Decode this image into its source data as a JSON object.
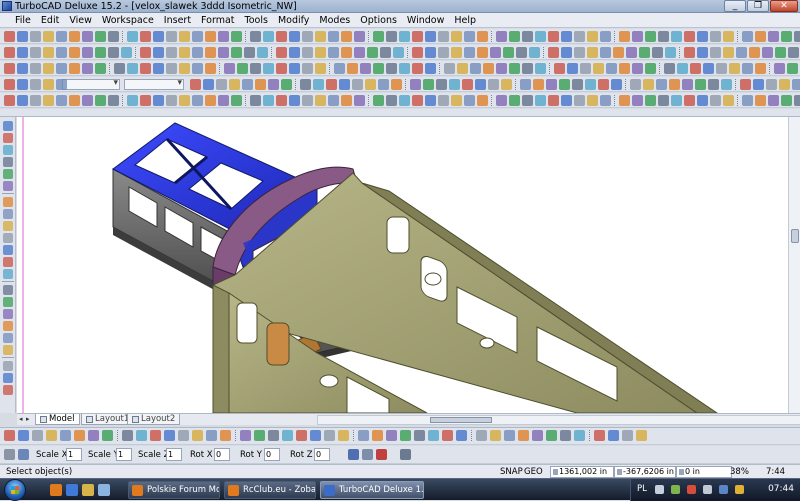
{
  "window": {
    "title": "TurboCAD Deluxe 15.2 - [velox_slawek 3ddd Isometric_NW]",
    "controls": {
      "minimize": "_",
      "restore": "❐",
      "close": "✕"
    }
  },
  "menu": [
    "File",
    "Edit",
    "View",
    "Workspace",
    "Insert",
    "Format",
    "Tools",
    "Modify",
    "Modes",
    "Options",
    "Window",
    "Help"
  ],
  "layout_tabs": [
    {
      "label": "Model",
      "active": true
    },
    {
      "label": "Layout1",
      "active": false
    },
    {
      "label": "Layout2",
      "active": false
    }
  ],
  "inspector": {
    "fields": [
      {
        "label": "Scale X",
        "value": "1"
      },
      {
        "label": "Scale Y",
        "value": "1"
      },
      {
        "label": "Scale Z",
        "value": "1"
      },
      {
        "label": "Rot X",
        "value": "0"
      },
      {
        "label": "Rot Y",
        "value": "0"
      },
      {
        "label": "Rot Z",
        "value": "0"
      }
    ]
  },
  "status": {
    "prompt": "Select object(s)",
    "snap": "SNAP",
    "geo": "GEO",
    "coord_x": "1361,002 in",
    "coord_y": "-367,6206 in",
    "coord_z": "0 in",
    "zoom": "38%",
    "time": "7:44"
  },
  "taskbar": {
    "tasks": [
      {
        "label": "Polskie Forum Mod...",
        "active": false
      },
      {
        "label": "RcClub.eu - Zobacz ...",
        "active": false
      },
      {
        "label": "TurboCAD Deluxe 1...",
        "active": true
      }
    ],
    "language": "PL",
    "clock": "07:44"
  },
  "colors": {
    "blue_part": "#2838d8",
    "olive_frame": "#a6a576",
    "purple_former": "#8a5a86",
    "dark_plate": "#4e4e4e",
    "wood": "#c98a45",
    "gray_frame": "#6e6e6e"
  }
}
